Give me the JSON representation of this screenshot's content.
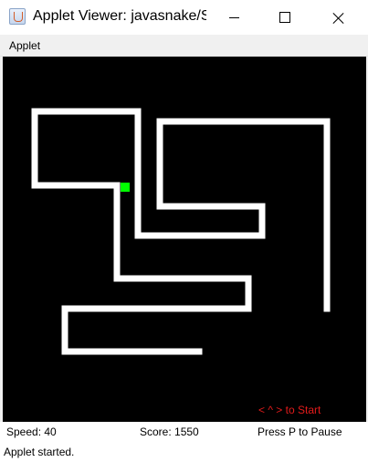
{
  "window": {
    "title": "Applet Viewer: javasnake/S..."
  },
  "menubar": {
    "items": [
      "Applet"
    ]
  },
  "game": {
    "background": "#000000",
    "snake_color": "#ffffff",
    "food_color": "#00ff00",
    "hint": "< ^ > to Start",
    "hint_color": "#e21b1b"
  },
  "status": {
    "speed": "Speed: 40",
    "score": "Score: 1550",
    "pause": "Press P to Pause"
  },
  "applet_status": "Applet started."
}
